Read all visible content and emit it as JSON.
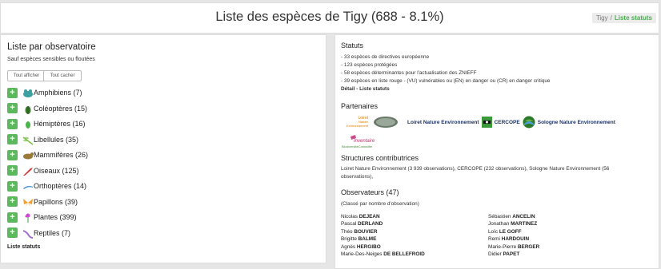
{
  "header": {
    "title": "Liste des espèces de Tigy",
    "count": "(688 - 8.1%)",
    "breadcrumb": {
      "home": "Tigy",
      "separator": "/",
      "current": "Liste statuts"
    }
  },
  "left": {
    "title": "Liste par observatoire",
    "subtitle": "Sauf espèces sensibles ou floutées",
    "show_all": "Tout afficher",
    "hide_all": "Tout cacher",
    "groups": [
      {
        "label": "Amphibiens (7)",
        "icon": "frog-icon",
        "color": "#3aa0a0"
      },
      {
        "label": "Coléoptères (15)",
        "icon": "beetle-icon",
        "color": "#3a7a2a"
      },
      {
        "label": "Hémiptères (16)",
        "icon": "bug-icon",
        "color": "#4cb34c"
      },
      {
        "label": "Libellules (35)",
        "icon": "dragonfly-icon",
        "color": "#7cc04a"
      },
      {
        "label": "Mammifères (26)",
        "icon": "mammal-icon",
        "color": "#9a7a3a"
      },
      {
        "label": "Oiseaux (125)",
        "icon": "bird-icon",
        "color": "#d03a3a"
      },
      {
        "label": "Orthoptères (14)",
        "icon": "grasshopper-icon",
        "color": "#4a9ad0"
      },
      {
        "label": "Papillons (39)",
        "icon": "butterfly-icon",
        "color": "#f0a030"
      },
      {
        "label": "Plantes (399)",
        "icon": "flower-icon",
        "color": "#d04ad0"
      },
      {
        "label": "Reptiles (7)",
        "icon": "lizard-icon",
        "color": "#a06ad0"
      }
    ],
    "plus": "+",
    "footer_link": "Liste statuts"
  },
  "right": {
    "statuts_title": "Statuts",
    "statuts_lines": [
      "- 33 espèces de directives européenne",
      "- 123 espèces protégées",
      "- 58 espèces déterminantes pour l'actualisation des ZNIEFF",
      "- 39 espèces en liste rouge - (VU) vulnérables ou (EN) en danger ou (CR) en danger critique"
    ],
    "statuts_link": "Détail - Liste statuts",
    "partenaires_title": "Partenaires",
    "partners": [
      {
        "logo": "loiret-nature-logo",
        "logo_text": "Loiret Nature Environnement",
        "name": "Loiret Nature Environnement"
      },
      {
        "logo": "cercope-logo",
        "name": "CERCOPE"
      },
      {
        "logo": "sologne-nature-logo",
        "name": "Sologne Nature Environnement"
      }
    ],
    "inventaire_logo_text": "Inventaire BiodiversitéConnaître",
    "structures_title": "Structures contributrices",
    "structures_text_1": "Loiret Nature Environnement (3 939 observations), CERCOPE (232 observations), Sologne Nature Environnement (56",
    "structures_text_2": "observations),",
    "observateurs_title": "Observateurs (47)",
    "observateurs_note": "(Classé par nombre d'observation)",
    "observers_left": [
      {
        "first": "Nicolas",
        "last": "DEJEAN"
      },
      {
        "first": "Pascal",
        "last": "DERLAND"
      },
      {
        "first": "Théo",
        "last": "BOUVIER"
      },
      {
        "first": "Brigitte",
        "last": "BALME"
      },
      {
        "first": "Agnès",
        "last": "HERGIBO"
      },
      {
        "first": "Marie-Des-Neiges",
        "last": "DE BELLEFROID"
      }
    ],
    "observers_right": [
      {
        "first": "Sébastien",
        "last": "ANCELIN"
      },
      {
        "first": "Jonathan",
        "last": "MARTINEZ"
      },
      {
        "first": "Loïc",
        "last": "LE GOFF"
      },
      {
        "first": "Remi",
        "last": "HARDOUIN"
      },
      {
        "first": "Marie-Pierre",
        "last": "BERGER"
      },
      {
        "first": "Didier",
        "last": "PAPET"
      }
    ]
  },
  "colors": {
    "accent": "#5cb85c",
    "breadcrumb_active": "#4caf50",
    "partner_text": "#1a2e5c"
  }
}
